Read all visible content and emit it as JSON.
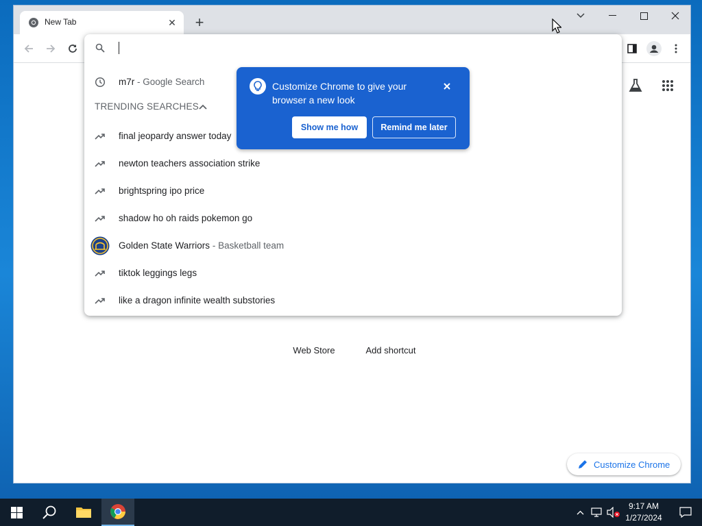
{
  "browser": {
    "tab": {
      "title": "New Tab",
      "close_glyph": "✕",
      "favicon": "chrome-icon"
    },
    "new_tab_glyph": "+",
    "window_controls": [
      "chevron-down-icon",
      "minimize-icon",
      "maximize-icon",
      "close-icon"
    ]
  },
  "omnibox": {
    "input_value": "",
    "history_suggestion": {
      "query": "m7r",
      "separator": "-",
      "description": "Google Search"
    },
    "trending_header": "TRENDING SEARCHES",
    "trending": [
      {
        "text": "final jeopardy answer today"
      },
      {
        "text": "newton teachers association strike"
      },
      {
        "text": "brightspring ipo price"
      },
      {
        "text": "shadow ho oh raids pokemon go"
      },
      {
        "text": "Golden State Warriors",
        "separator": "-",
        "description": "Basketball team",
        "icon": "warriors-logo"
      },
      {
        "text": "tiktok leggings legs"
      },
      {
        "text": "like a dragon infinite wealth substories"
      }
    ]
  },
  "iph": {
    "text": "Customize Chrome to give your browser a new look",
    "show_label": "Show me how",
    "later_label": "Remind me later",
    "icon": "lightbulb-icon"
  },
  "ntp": {
    "shortcuts": [
      {
        "label": "Web Store"
      },
      {
        "label": "Add shortcut"
      }
    ],
    "customize_label": "Customize Chrome"
  },
  "taskbar": {
    "time": "9:17 AM",
    "date": "1/27/2024"
  },
  "colors": {
    "accent": "#1a73e8",
    "iph_bg": "#1a62d0",
    "taskbar_bg": "#101d2b",
    "desktop_bg": "#1574c4"
  }
}
